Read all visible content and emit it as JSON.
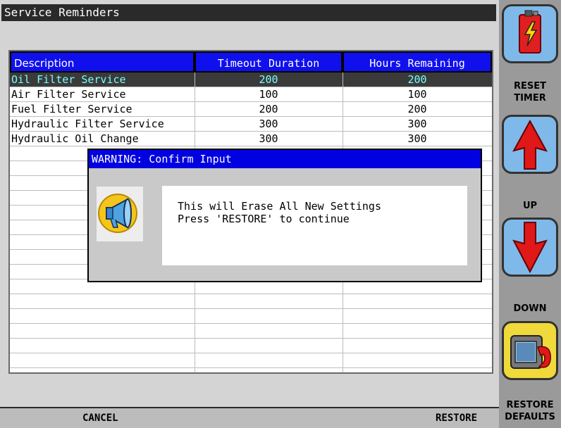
{
  "window": {
    "title": "Service Reminders"
  },
  "table": {
    "columns": [
      "Description",
      "Timeout Duration",
      "Hours Remaining"
    ],
    "rows": [
      {
        "description": "Oil Filter Service",
        "timeout": "200",
        "remaining": "200"
      },
      {
        "description": "Air Filter Service",
        "timeout": "100",
        "remaining": "100"
      },
      {
        "description": "Fuel Filter Service",
        "timeout": "200",
        "remaining": "200"
      },
      {
        "description": "Hydraulic Filter Service",
        "timeout": "300",
        "remaining": "300"
      },
      {
        "description": "Hydraulic Oil Change",
        "timeout": "300",
        "remaining": "300"
      }
    ],
    "selected_row": 0
  },
  "dialog": {
    "title": "WARNING: Confirm Input",
    "line1": "This will Erase All New Settings",
    "line2": "Press 'RESTORE' to continue",
    "icon": "megaphone-icon"
  },
  "bottom_bar": {
    "cancel_label": "CANCEL",
    "restore_label": "RESTORE"
  },
  "side_panel": {
    "reset_label_1": "RESET",
    "reset_label_2": "TIMER",
    "up_label": "UP",
    "down_label": "DOWN",
    "restore_defaults_label_1": "RESTORE",
    "restore_defaults_label_2": "DEFAULTS"
  },
  "colors": {
    "header_blue": "#1010ee",
    "selection_bg": "#3a3a3a",
    "selection_text": "#77ffff",
    "tile_blue": "#7fb9e9",
    "tile_yellow": "#f0d93a",
    "arrow_red": "#e01818"
  }
}
